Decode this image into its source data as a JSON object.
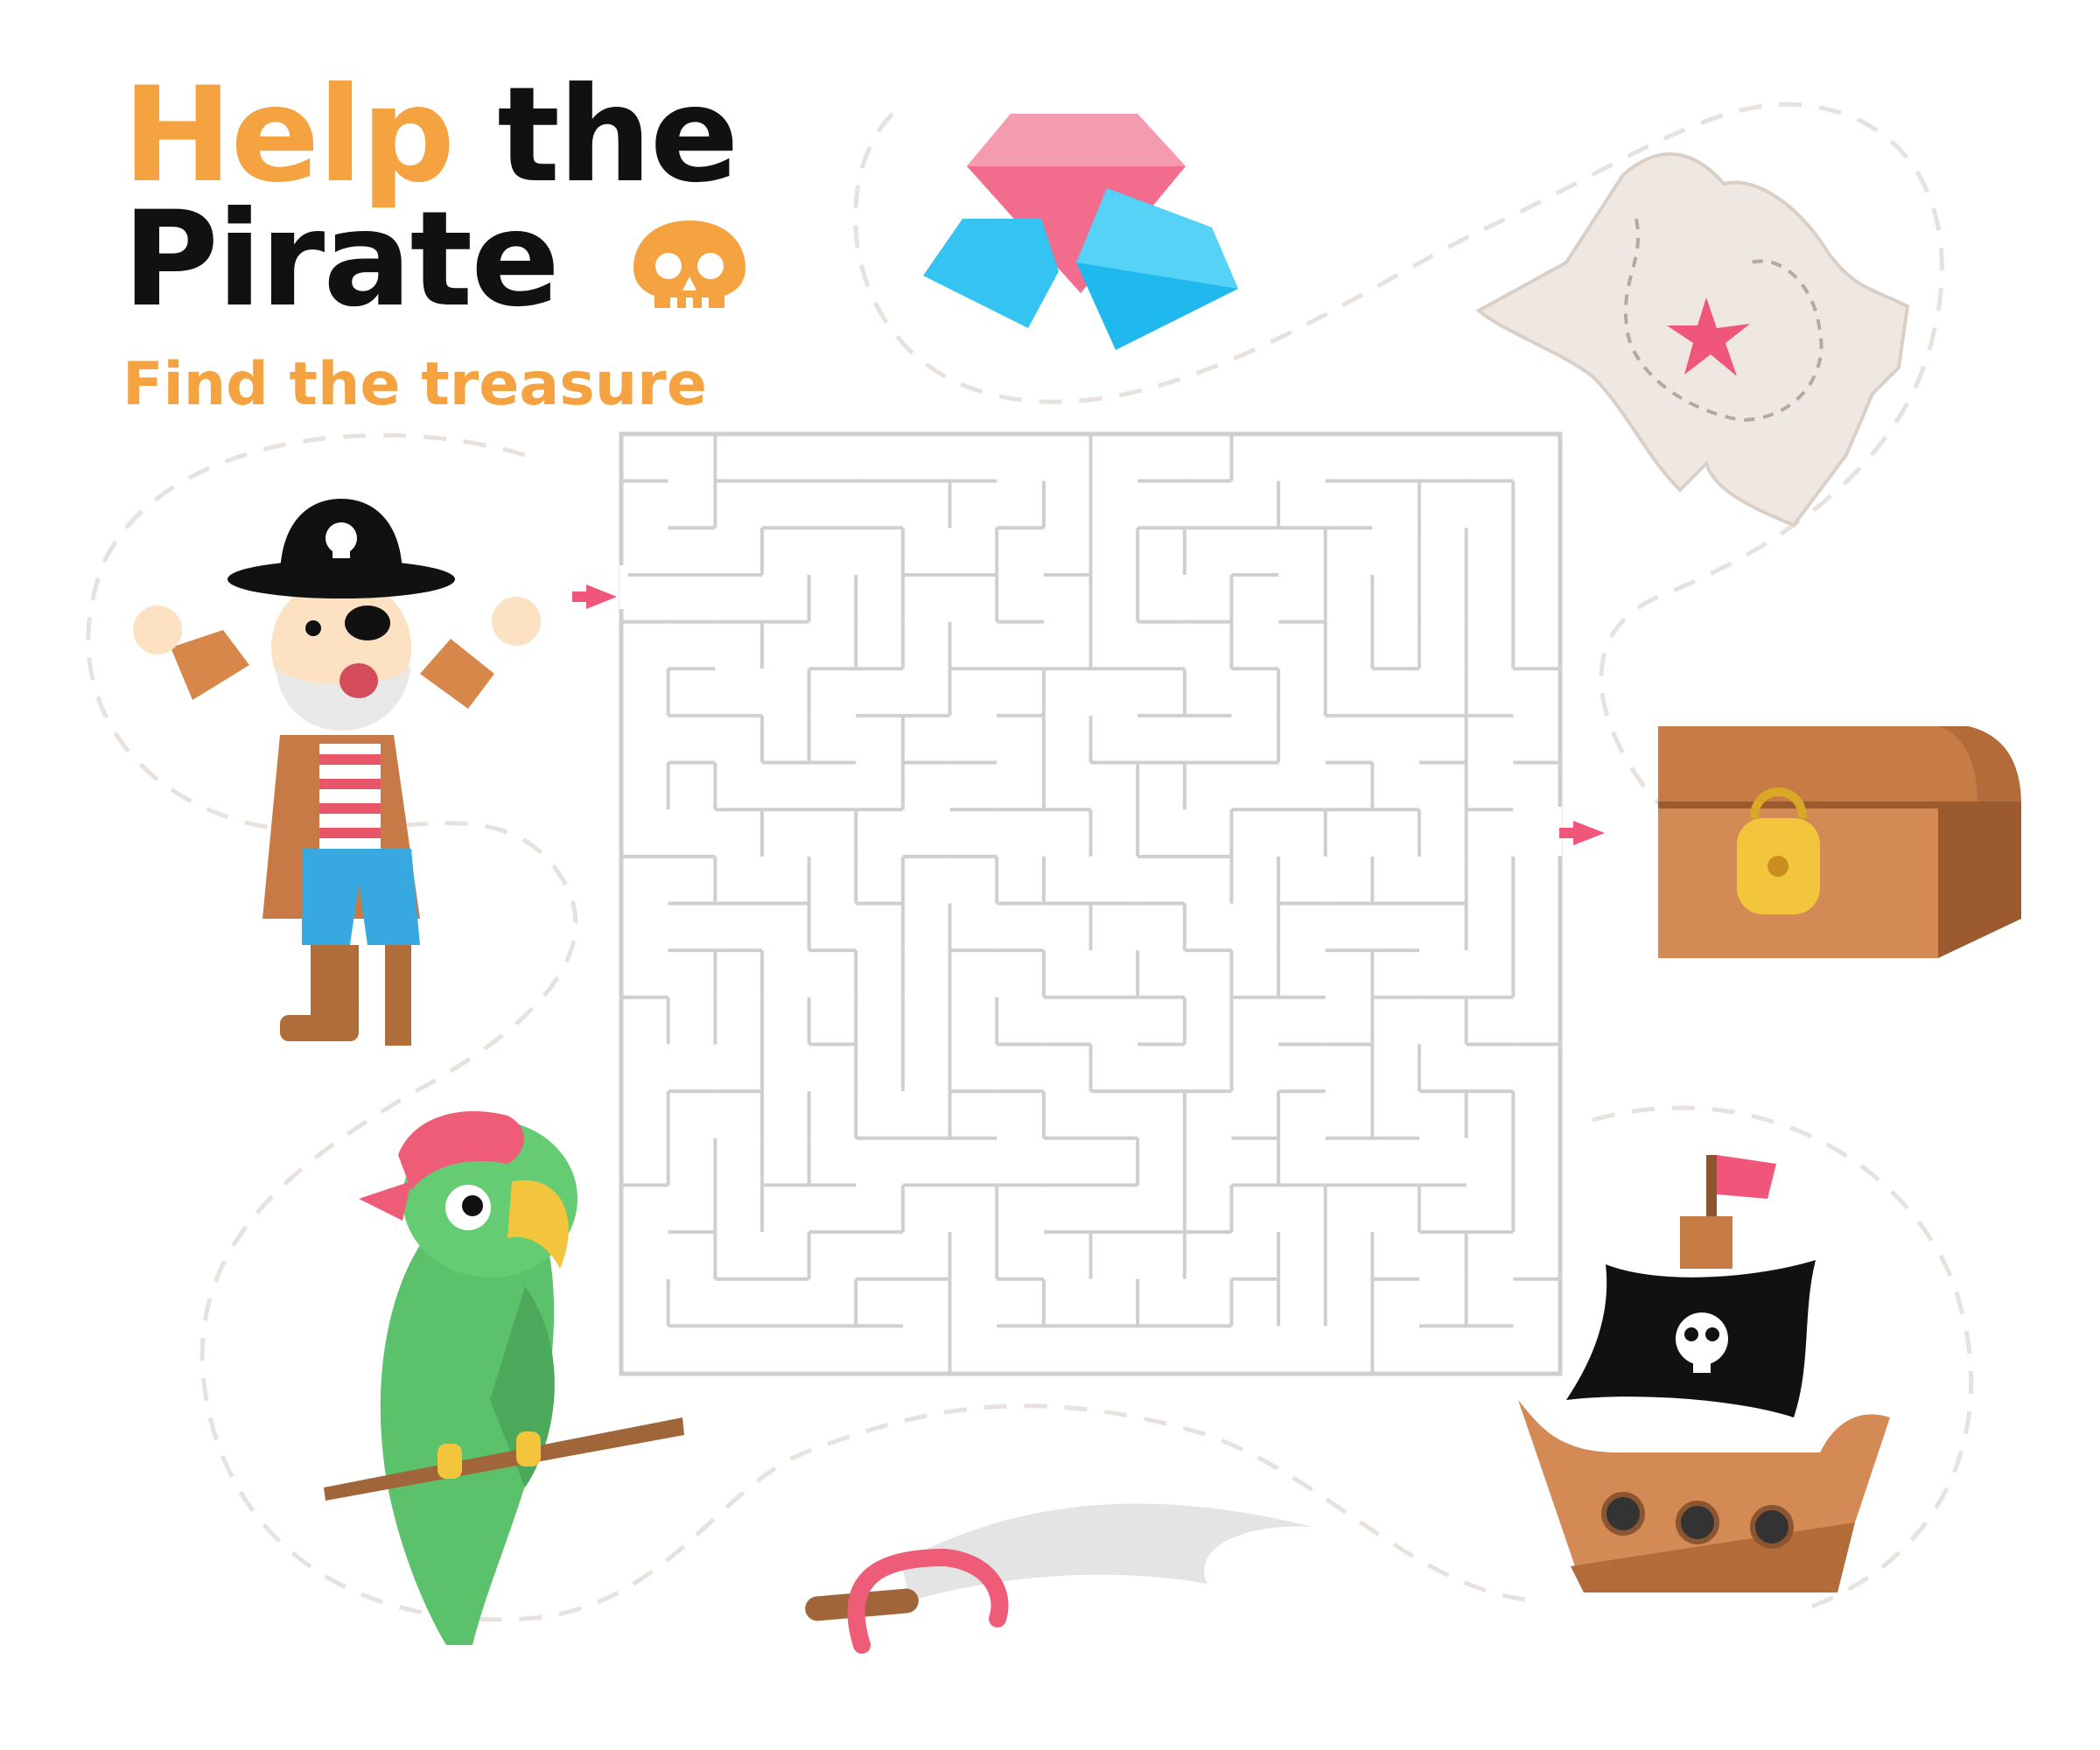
{
  "title": {
    "word1": "Help",
    "word2": "the",
    "word3": "Pirate",
    "subtitle": "Find the treasure"
  },
  "colors": {
    "accent_orange": "#F4A340",
    "title_dark": "#111111",
    "maze_wall": "#CFCFCF",
    "arrow_pink": "#F0557A",
    "dashed_path": "#E8E2DE"
  },
  "icons": [
    "pirate-captain",
    "gems",
    "treasure-map",
    "treasure-chest",
    "parrot",
    "sabre",
    "pirate-ship",
    "skull"
  ]
}
